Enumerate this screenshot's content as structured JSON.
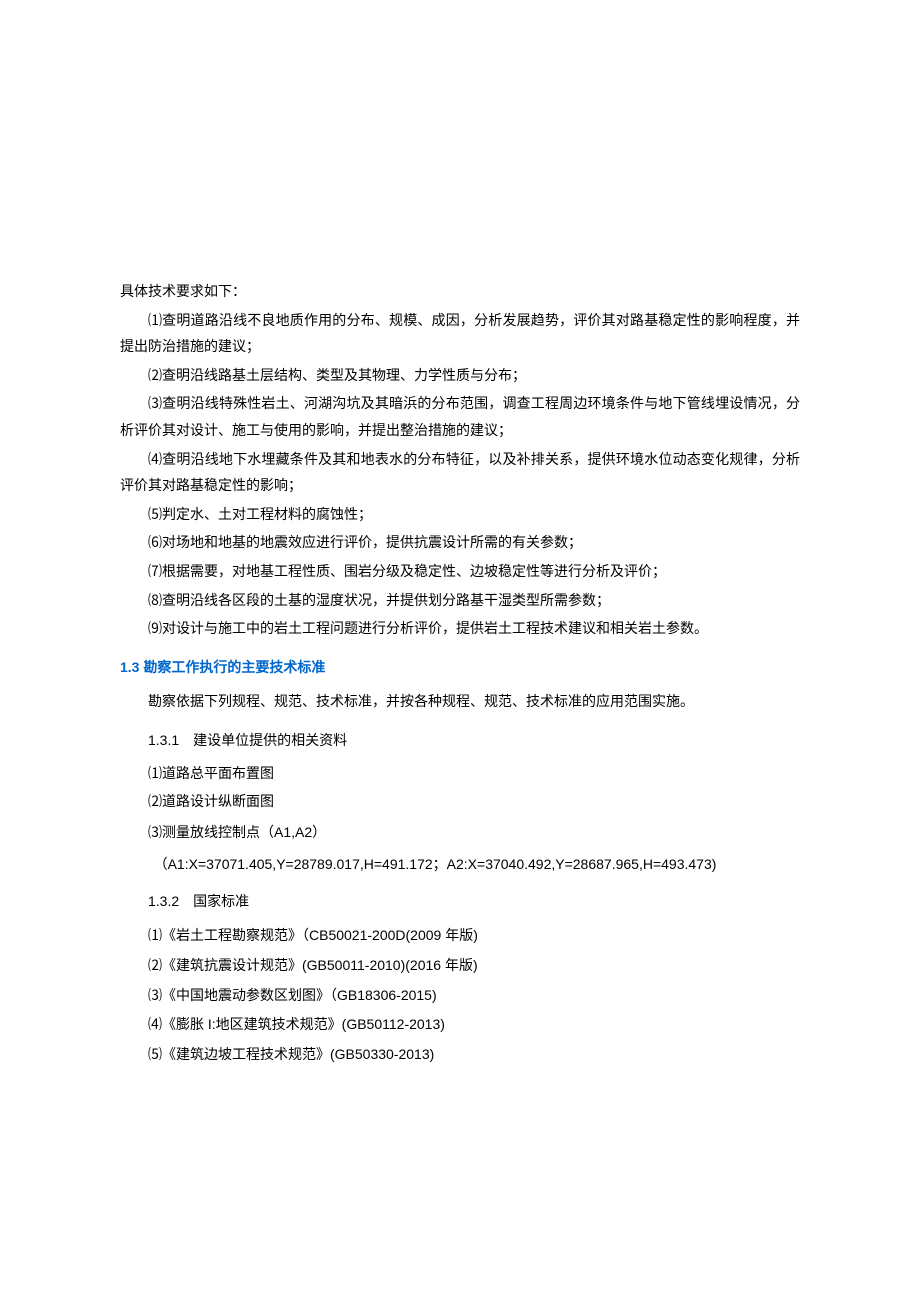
{
  "intro": "具体技术要求如下：",
  "requirements": [
    "⑴查明道路沿线不良地质作用的分布、规模、成因，分析发展趋势，评价其对路基稳定性的影响程度，并提出防治措施的建议；",
    "⑵查明沿线路基土层结构、类型及其物理、力学性质与分布；",
    "⑶查明沿线特殊性岩土、河湖沟坑及其暗浜的分布范围，调查工程周边环境条件与地下管线埋设情况，分析评价其对设计、施工与使用的影响，并提出整治措施的建议；",
    "⑷查明沿线地下水埋藏条件及其和地表水的分布特征，以及补排关系，提供环境水位动态变化规律，分析评价其对路基稳定性的影响；",
    "⑸判定水、土对工程材料的腐蚀性；",
    "⑹对场地和地基的地震效应进行评价，提供抗震设计所需的有关参数；",
    "⑺根据需要，对地基工程性质、围岩分级及稳定性、边坡稳定性等进行分析及评价；",
    "⑻查明沿线各区段的土基的湿度状况，并提供划分路基干湿类型所需参数；",
    "⑼对设计与施工中的岩土工程问题进行分析评价，提供岩土工程技术建议和相关岩土参数。"
  ],
  "section_1_3": {
    "title": "1.3 勘察工作执行的主要技术标准",
    "intro": "勘察依据下列规程、规范、技术标准，并按各种规程、规范、技术标准的应用范围实施。",
    "sub_1_3_1": {
      "title": "1.3.1　建设单位提供的相关资料",
      "items": [
        "⑴道路总平面布置图",
        "⑵道路设计纵断面图",
        "⑶测量放线控制点（A1,A2）"
      ],
      "coords": "（A1:X=37071.405,Y=28789.017,H=491.172；A2:X=37040.492,Y=28687.965,H=493.473)"
    },
    "sub_1_3_2": {
      "title": "1.3.2　国家标准",
      "items": [
        "⑴《岩土工程勘察规范》（CB50021-200D(2009 年版)",
        "⑵《建筑抗震设计规范》(GB50011-2010)(2016 年版)",
        "⑶《中国地震动参数区划图》（GB18306-2015)",
        "⑷《膨胀 I:地区建筑技术规范》(GB50112-2013)",
        "⑸《建筑边坡工程技术规范》(GB50330-2013)"
      ]
    }
  }
}
